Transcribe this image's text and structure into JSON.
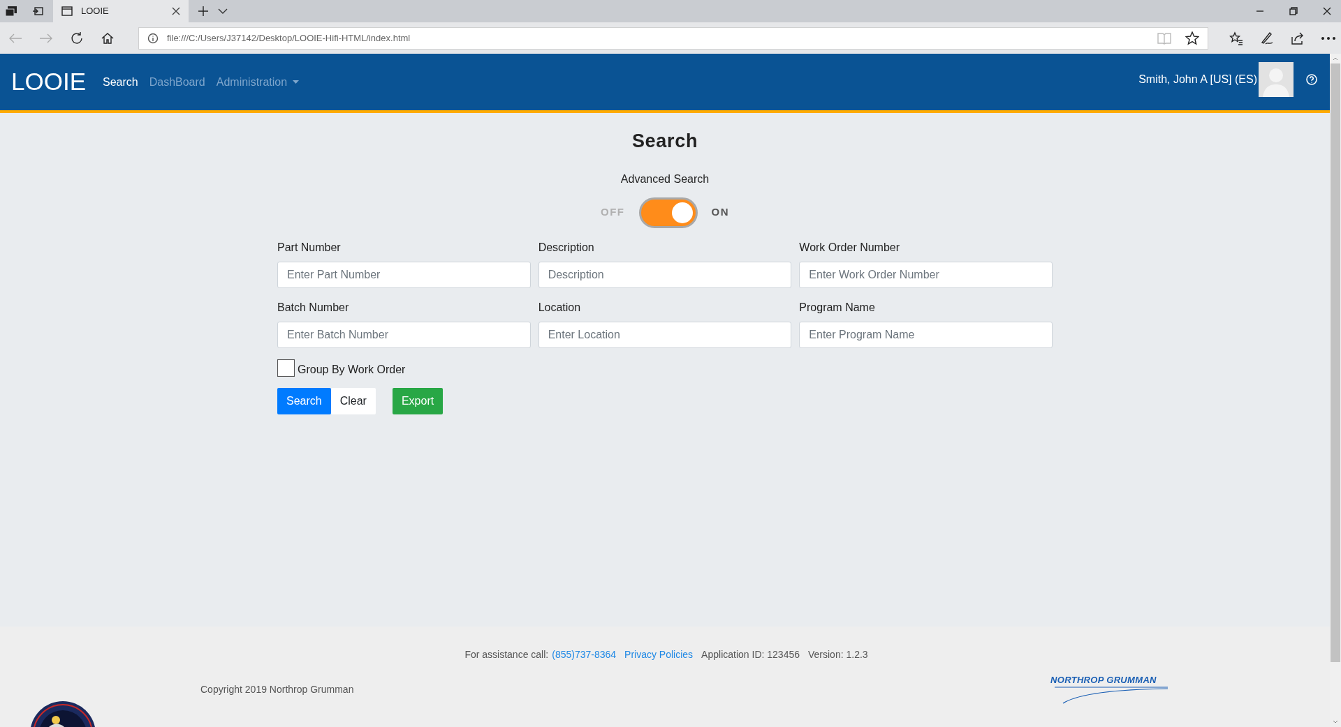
{
  "browser": {
    "tab_title": "LOOIE",
    "address": "file:///C:/Users/J37142/Desktop/LOOIE-Hifi-HTML/index.html"
  },
  "navbar": {
    "brand": "LOOIE",
    "items": [
      {
        "label": "Search",
        "selected": true,
        "kind": "link"
      },
      {
        "label": "DashBoard",
        "selected": false,
        "kind": "link"
      },
      {
        "label": "Administration",
        "selected": false,
        "kind": "dropdown"
      }
    ],
    "user": "Smith, John A [US] (ES)"
  },
  "page_title": "Search",
  "advanced_search": {
    "label": "Advanced Search",
    "off_label": "OFF",
    "on_label": "ON",
    "on": true
  },
  "fields": [
    {
      "label": "Part Number",
      "placeholder": "Enter Part Number"
    },
    {
      "label": "Description",
      "placeholder": "Description"
    },
    {
      "label": "Work Order Number",
      "placeholder": "Enter Work Order Number"
    },
    {
      "label": "Batch Number",
      "placeholder": "Enter Batch Number"
    },
    {
      "label": "Location",
      "placeholder": "Enter Location"
    },
    {
      "label": "Program Name",
      "placeholder": "Enter Program Name"
    }
  ],
  "group_by": {
    "label": "Group By Work Order",
    "checked": false
  },
  "buttons": [
    {
      "label": "Search",
      "kind": "primary"
    },
    {
      "label": "Clear",
      "kind": "light"
    },
    {
      "label": "Export",
      "kind": "success"
    }
  ],
  "footer": {
    "assistance": "For assistance call:",
    "phone": "(855)737-8364",
    "privacy": "Privacy Policies",
    "app_id": "Application ID: 123456",
    "version": "Version: 1.2.3",
    "copyright": "Copyright 2019 Northrop Grumman",
    "logo_text": "NORTHROP GRUMMAN"
  }
}
